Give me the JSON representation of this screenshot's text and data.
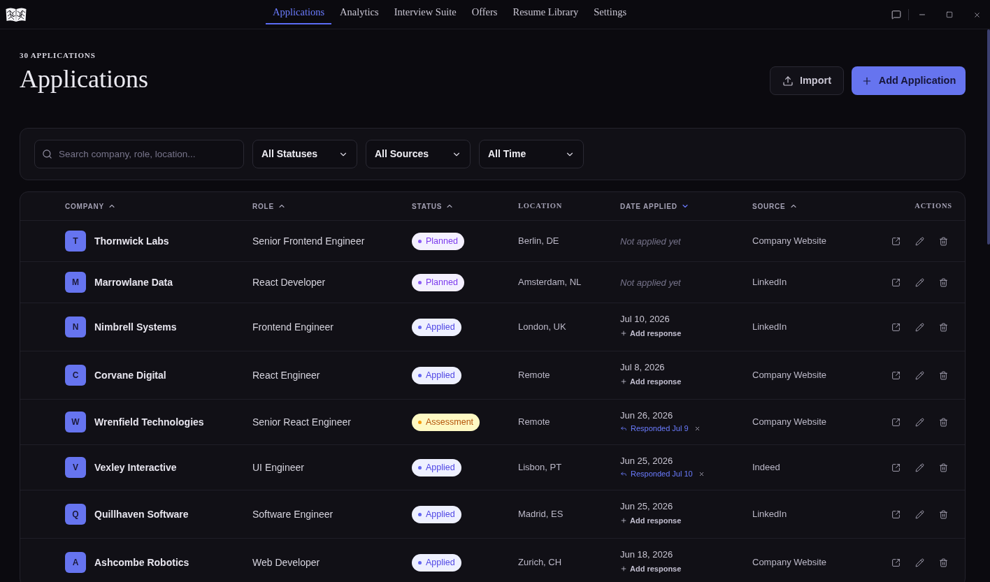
{
  "nav": [
    {
      "label": "Applications",
      "selected": true
    },
    {
      "label": "Analytics",
      "selected": false
    },
    {
      "label": "Interview Suite",
      "selected": false
    },
    {
      "label": "Offers",
      "selected": false
    },
    {
      "label": "Resume Library",
      "selected": false
    },
    {
      "label": "Settings",
      "selected": false
    }
  ],
  "page_header": {
    "count_label": "30 APPLICATIONS",
    "title": "Applications"
  },
  "header_buttons": [
    {
      "label": "Import",
      "kind": "secondary"
    },
    {
      "label": "Add Application",
      "kind": "primary"
    }
  ],
  "filters": {
    "search": {
      "placeholder": "Search company, role, location..."
    },
    "dropdowns": [
      {
        "value": "All Statuses"
      },
      {
        "value": "All Sources"
      },
      {
        "value": "All Time"
      }
    ]
  },
  "table": {
    "columns": [
      {
        "label": "COMPANY",
        "sortable": true,
        "descending": false,
        "active": false
      },
      {
        "label": "ROLE",
        "sortable": true,
        "descending": false,
        "active": false
      },
      {
        "label": "STATUS",
        "sortable": true,
        "descending": false,
        "active": false
      },
      {
        "label": "LOCATION",
        "sortable": false
      },
      {
        "label": "DATE APPLIED",
        "sortable": true,
        "descending": true,
        "active": true
      },
      {
        "label": "SOURCE",
        "sortable": true,
        "descending": false,
        "active": false
      },
      {
        "label": "ACTIONS",
        "sortable": false
      }
    ],
    "rows": [
      {
        "initial": "T",
        "company": "Thornwick Labs",
        "role": "Senior Frontend Engineer",
        "status": {
          "label": "Planned",
          "kind": "planned",
          "color": "#8b5cf6"
        },
        "location": "Berlin, DE",
        "date_applied": {
          "kind": "not_applied",
          "text": "Not applied yet"
        },
        "source": "Company Website"
      },
      {
        "initial": "M",
        "company": "Marrowlane Data",
        "role": "React Developer",
        "status": {
          "label": "Planned",
          "kind": "planned",
          "color": "#8b5cf6"
        },
        "location": "Amsterdam, NL",
        "date_applied": {
          "kind": "not_applied",
          "text": "Not applied yet"
        },
        "source": "LinkedIn"
      },
      {
        "initial": "N",
        "company": "Nimbrell Systems",
        "role": "Frontend Engineer",
        "status": {
          "label": "Applied",
          "kind": "applied",
          "color": "#6366f1"
        },
        "location": "London, UK",
        "date_applied": {
          "kind": "applied",
          "date": "Jul 10, 2026",
          "response": {
            "kind": "add",
            "label": "Add response"
          }
        },
        "source": "LinkedIn"
      },
      {
        "initial": "C",
        "company": "Corvane Digital",
        "role": "React Engineer",
        "status": {
          "label": "Applied",
          "kind": "applied",
          "color": "#6366f1"
        },
        "location": "Remote",
        "date_applied": {
          "kind": "applied",
          "date": "Jul 8, 2026",
          "response": {
            "kind": "add",
            "label": "Add response"
          }
        },
        "source": "Company Website"
      },
      {
        "initial": "W",
        "company": "Wrenfield Technologies",
        "role": "Senior React Engineer",
        "status": {
          "label": "Assessment",
          "kind": "assessment",
          "color": "#f59e0b"
        },
        "location": "Remote",
        "date_applied": {
          "kind": "applied",
          "date": "Jun 26, 2026",
          "response": {
            "kind": "responded",
            "label": "Responded Jul 9"
          }
        },
        "source": "Company Website"
      },
      {
        "initial": "V",
        "company": "Vexley Interactive",
        "role": "UI Engineer",
        "status": {
          "label": "Applied",
          "kind": "applied",
          "color": "#6366f1"
        },
        "location": "Lisbon, PT",
        "date_applied": {
          "kind": "applied",
          "date": "Jun 25, 2026",
          "response": {
            "kind": "responded",
            "label": "Responded Jul 10"
          }
        },
        "source": "Indeed"
      },
      {
        "initial": "Q",
        "company": "Quillhaven Software",
        "role": "Software Engineer",
        "status": {
          "label": "Applied",
          "kind": "applied",
          "color": "#6366f1"
        },
        "location": "Madrid, ES",
        "date_applied": {
          "kind": "applied",
          "date": "Jun 25, 2026",
          "response": {
            "kind": "add",
            "label": "Add response"
          }
        },
        "source": "LinkedIn"
      },
      {
        "initial": "A",
        "company": "Ashcombe Robotics",
        "role": "Web Developer",
        "status": {
          "label": "Applied",
          "kind": "applied",
          "color": "#6366f1"
        },
        "location": "Zurich, CH",
        "date_applied": {
          "kind": "applied",
          "date": "Jun 18, 2026",
          "response": {
            "kind": "add",
            "label": "Add response"
          }
        },
        "source": "Company Website"
      }
    ]
  }
}
